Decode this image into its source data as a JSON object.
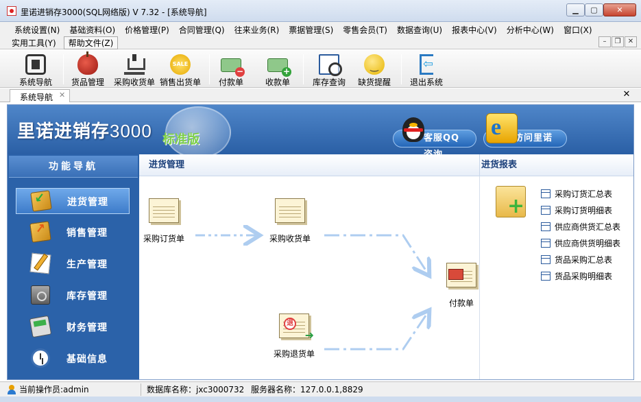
{
  "window": {
    "title": "里诺进销存3000(SQL网络版) V 7.32 - [系统导航]",
    "buttons": {
      "minimize": "▁",
      "maximize": "▢",
      "close": "✕"
    }
  },
  "menubar": {
    "row1": [
      "系统设置(N)",
      "基础资料(O)",
      "价格管理(P)",
      "合同管理(Q)",
      "往来业务(R)",
      "票据管理(S)",
      "零售会员(T)",
      "数据查询(U)",
      "报表中心(V)",
      "分析中心(W)",
      "窗口(X)"
    ],
    "row2": [
      "实用工具(Y)",
      "帮助文件(Z)"
    ],
    "mdi_buttons": [
      "–",
      "❐",
      "✕"
    ]
  },
  "toolbar": {
    "items": [
      {
        "label": "系统导航",
        "icon": "navigation-icon"
      },
      {
        "label": "货品管理",
        "icon": "apple-icon"
      },
      {
        "label": "采购收货单",
        "icon": "cart-icon"
      },
      {
        "label": "销售出货单",
        "icon": "sale-tag-icon"
      },
      {
        "label": "付款单",
        "icon": "payment-money-icon"
      },
      {
        "label": "收款单",
        "icon": "receipt-money-icon"
      },
      {
        "label": "库存查询",
        "icon": "inventory-search-icon"
      },
      {
        "label": "缺货提醒",
        "icon": "shortage-alert-icon"
      },
      {
        "label": "退出系统",
        "icon": "exit-icon"
      }
    ]
  },
  "tabs": {
    "active": "系统导航",
    "close_glyph": "✕",
    "panel_close_glyph": "✕"
  },
  "banner": {
    "logo_text": "里诺进销存",
    "logo_number": "3000",
    "edition": "标准版",
    "qq_button": "客服QQ咨询",
    "visit_button": "访问里诺"
  },
  "sidebar": {
    "header": "功能导航",
    "active_index": 0,
    "items": [
      {
        "label": "进货管理",
        "icon": "purchase-box-icon"
      },
      {
        "label": "销售管理",
        "icon": "sales-box-icon"
      },
      {
        "label": "生产管理",
        "icon": "production-pencil-icon"
      },
      {
        "label": "库存管理",
        "icon": "inventory-safe-icon"
      },
      {
        "label": "财务管理",
        "icon": "finance-pos-icon"
      },
      {
        "label": "基础信息",
        "icon": "basic-info-clock-icon"
      }
    ]
  },
  "purchase": {
    "header": "进货管理",
    "flow": {
      "order": "采购订货单",
      "receipt": "采购收货单",
      "return": "采购退货单",
      "payment": "付款单",
      "return_badge": "退"
    }
  },
  "reports": {
    "header": "进货报表",
    "items": [
      "采购订货汇总表",
      "采购订货明细表",
      "供应商供货汇总表",
      "供应商供货明细表",
      "货品采购汇总表",
      "货品采购明细表"
    ]
  },
  "statusbar": {
    "operator": "当前操作员:admin",
    "database": "数据库名称：jxc3000732",
    "server": "服务器名称：127.0.0.1,8829"
  },
  "colors": {
    "banner": "#2a5fa5",
    "sidebar": "#2b62a9",
    "flow_arrow": "#aecdf0",
    "section_header_text": "#1a3f7a"
  }
}
